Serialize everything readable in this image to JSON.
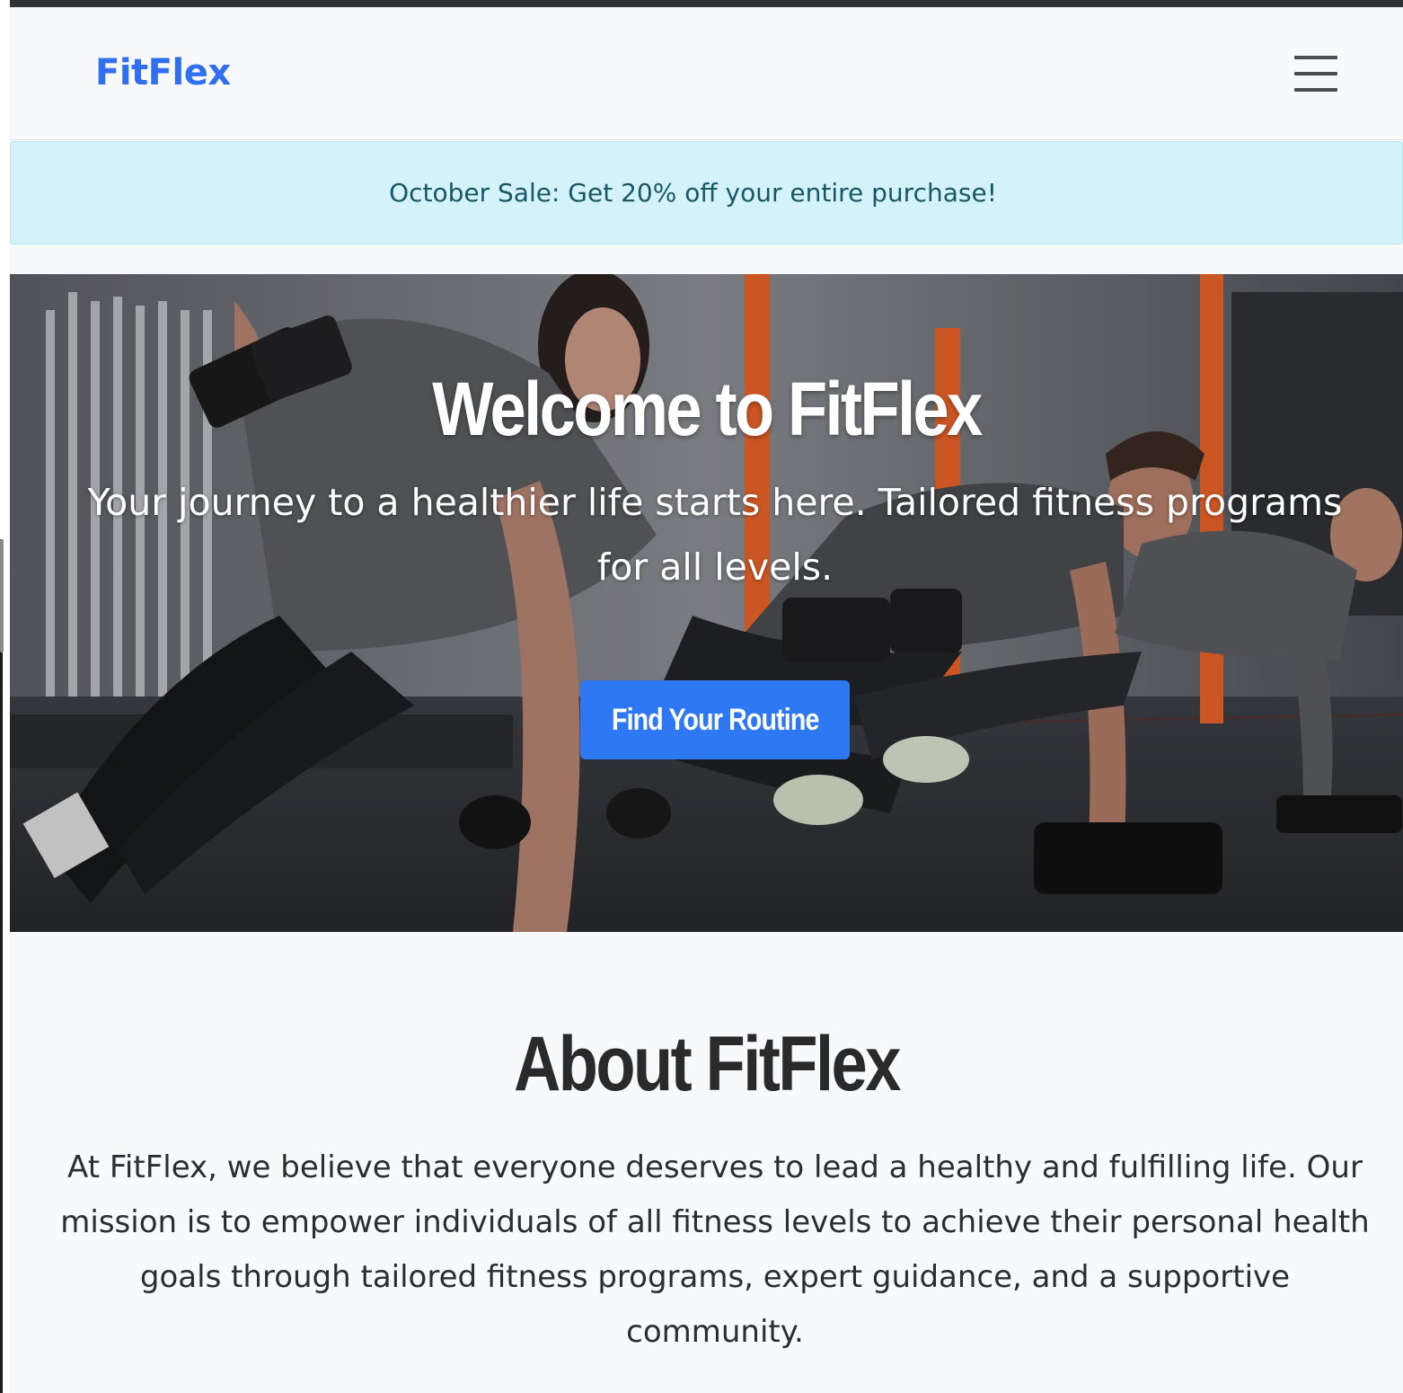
{
  "navbar": {
    "brand": "FitFlex",
    "menu_icon": "hamburger-menu-icon"
  },
  "promo": {
    "text": "October Sale: Get 20% off your entire purchase!"
  },
  "hero": {
    "title": "Welcome to FitFlex",
    "subtitle": "Your journey to a healthier life starts here. Tailored fitness programs for all levels.",
    "cta_label": "Find Your Routine",
    "image_alt": "People doing plank rows with dumbbells in a gym"
  },
  "about": {
    "title": "About FitFlex",
    "text": "At FitFlex, we believe that everyone deserves to lead a healthy and fulfilling life. Our mission is to empower individuals of all fitness levels to achieve their personal health goals through tailored fitness programs, expert guidance, and a supportive community."
  },
  "colors": {
    "brand": "#2f6ff0",
    "cta": "#2f78f3",
    "promo_bg": "#d3f2f9",
    "promo_text": "#185765",
    "heading": "#2a2a2a"
  }
}
